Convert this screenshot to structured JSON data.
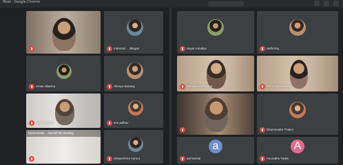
{
  "window": {
    "title": "Meet - Google Chrome"
  },
  "grid": {
    "left": [
      {
        "name": "",
        "type": "video"
      },
      {
        "name": "Indumati ... Bhagat",
        "type": "avatar"
      },
      {
        "name": "Aman Sharma",
        "type": "avatar"
      },
      {
        "name": "Shreya Tamang",
        "type": "avatar"
      },
      {
        "name": "Ruhi Sharma",
        "type": "video"
      },
      {
        "name": "anu jadhav",
        "type": "avatar"
      },
      {
        "name": "",
        "type": "video",
        "banner": "Dharmendra ... has left the meeting"
      },
      {
        "name": "Ishwarshree Aurora",
        "type": "avatar"
      }
    ],
    "right": [
      {
        "name": "Nayan Hiralkar",
        "type": "avatar"
      },
      {
        "name": "Nidhi Raj",
        "type": "avatar"
      },
      {
        "name": "Manashree Bhagat",
        "type": "video"
      },
      {
        "name": "Nisha Maheshwari",
        "type": "video"
      },
      {
        "name": "",
        "type": "video"
      },
      {
        "name": "Dharmendra Thakur",
        "type": "avatar"
      },
      {
        "name": "arti kansal",
        "type": "avatar",
        "initial": "a"
      },
      {
        "name": "Anuradha Yadav",
        "type": "avatar",
        "initial": "A"
      }
    ]
  },
  "colors": {
    "background": "#202124",
    "tile": "#3c4043",
    "mic_muted": "#e8453c",
    "avatar_a": "#e56b8a",
    "avatar_a_blue": "#6f8fc9"
  },
  "icons": {
    "mic": "mic-muted-icon"
  }
}
